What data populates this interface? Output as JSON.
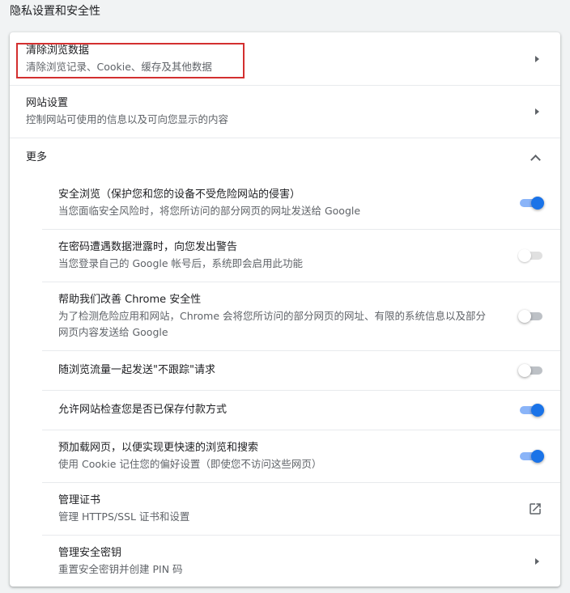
{
  "section_title": "隐私设置和安全性",
  "clear_data": {
    "label": "清除浏览数据",
    "sub": "清除浏览记录、Cookie、缓存及其他数据"
  },
  "site_settings": {
    "label": "网站设置",
    "sub": "控制网站可使用的信息以及可向您显示的内容"
  },
  "more": {
    "label": "更多"
  },
  "safe_browsing": {
    "label": "安全浏览（保护您和您的设备不受危险网站的侵害）",
    "sub": "当您面临安全风险时，将您所访问的部分网页的网址发送给 Google",
    "enabled": true
  },
  "password_leak": {
    "label": "在密码遭遇数据泄露时，向您发出警告",
    "sub": "当您登录自己的 Google 帐号后，系统即会启用此功能",
    "enabled": false
  },
  "improve_security": {
    "label": "帮助我们改善 Chrome 安全性",
    "sub1": "为了检测危险应用和网站，Chrome 会将您所访问的部分网页的网址、有限的系统信息以及部分",
    "sub2": "网页内容发送给 Google",
    "enabled": false
  },
  "do_not_track": {
    "label": "随浏览流量一起发送\"不跟踪\"请求",
    "enabled": false
  },
  "payment_methods": {
    "label": "允许网站检查您是否已保存付款方式",
    "enabled": true
  },
  "preload": {
    "label": "预加载网页，以便实现更快速的浏览和搜索",
    "sub": "使用 Cookie 记住您的偏好设置（即使您不访问这些网页）",
    "enabled": true
  },
  "certificates": {
    "label": "管理证书",
    "sub": "管理 HTTPS/SSL 证书和设置"
  },
  "security_keys": {
    "label": "管理安全密钥",
    "sub": "重置安全密钥并创建 PIN 码"
  },
  "colors": {
    "accent": "#1a73e8",
    "highlight_box": "#d32f2f"
  }
}
